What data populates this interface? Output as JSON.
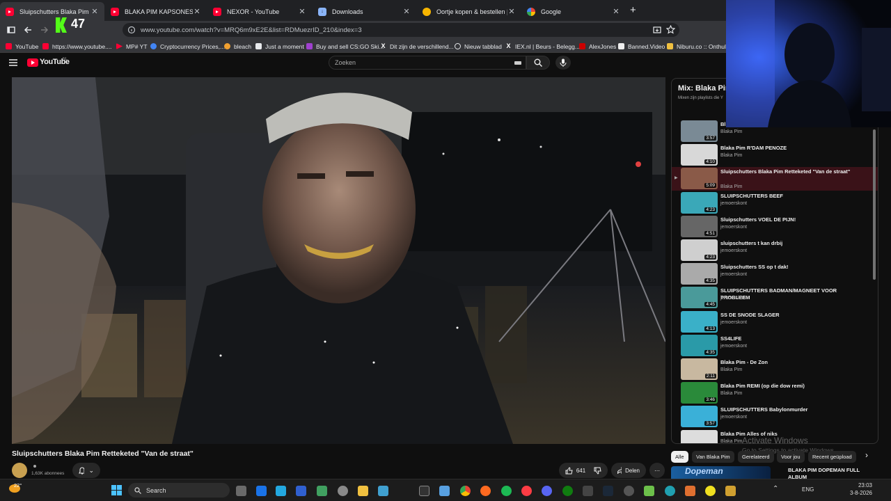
{
  "tabs": [
    {
      "title": "Sluipschutters Blaka Pim Re",
      "icon": "youtube-icon",
      "active": true
    },
    {
      "title": "BLAKA PIM KAPSONES - Yo",
      "icon": "youtube-icon"
    },
    {
      "title": "NEXOR - YouTube",
      "icon": "youtube-icon"
    },
    {
      "title": "Downloads",
      "icon": "download-icon"
    },
    {
      "title": "Oortje kopen & bestellen | Jum",
      "icon": "jumbo-icon"
    },
    {
      "title": "Google",
      "icon": "google-icon"
    }
  ],
  "new_tab": "+",
  "kick_count": "47",
  "address": "www.youtube.com/watch?v=MRQ6m9xE2E&list=RDMuezrID_210&index=3",
  "bookmarks": [
    "YouTube",
    "https://www.youtube....",
    "MP# YT",
    "Cryptocurrency Prices,...",
    "bleach",
    "Just a moment",
    "Buy and sell CS:GO Ski...",
    "Dit zijn de verschillend...",
    "Nieuw tabblad",
    "IEX.nl | Beurs - Belegg...",
    "AlexJones",
    "Banned.Video",
    "Niburu.co :: Onthulle"
  ],
  "yt": {
    "logo": "YouTube",
    "logo_sup": "NL",
    "search_placeholder": "Zoeken"
  },
  "video": {
    "title": "Sluipschutters Blaka Pim Retteketed \"Van de straat\"",
    "channel_subs": "1,63K abonnees",
    "likes": "641",
    "share": "Delen"
  },
  "playlist": {
    "title": "Mix: Blaka Pim",
    "subtitle": "Mixen zijn playlists die Y",
    "items": [
      {
        "title": "Bl",
        "channel": "Blaka Pim",
        "duration": "3:57",
        "thumb": "#7a8a95"
      },
      {
        "title": "Blaka Pim R'DAM PENOZE",
        "channel": "Blaka Pim",
        "duration": "4:10",
        "thumb": "#d8d8d8"
      },
      {
        "title": "Sluipschutters Blaka Pim Retteketed \"Van de straat\"",
        "channel": "Blaka Pim",
        "duration": "5:09",
        "thumb": "#8a5a48",
        "current": true
      },
      {
        "title": "SLUIPSCHUTTERS BEEF",
        "channel": "jemoerskont",
        "duration": "4:23",
        "thumb": "#3aa8b8"
      },
      {
        "title": "Sluipschutters VOEL DE PIJN!",
        "channel": "jemoerskont",
        "duration": "4:51",
        "thumb": "#666"
      },
      {
        "title": "sluipschutters t kan drbij",
        "channel": "jemoerskont",
        "duration": "4:23",
        "thumb": "#cfcfcf"
      },
      {
        "title": "Sluipschutters SS op t dak!",
        "channel": "jemoerskont",
        "duration": "4:35",
        "thumb": "#aaa"
      },
      {
        "title": "SLUIPSCHUTTERS BADMAN/MAGNEET VOOR PROBLEEM",
        "channel": "jemoerskont",
        "duration": "4:45",
        "thumb": "#4a9a9a"
      },
      {
        "title": "SS DE SNODE SLAGER",
        "channel": "jemoerskont",
        "duration": "4:13",
        "thumb": "#3ab0c8"
      },
      {
        "title": "SS4LIFE",
        "channel": "jemoerskont",
        "duration": "4:35",
        "thumb": "#2a9aa8"
      },
      {
        "title": "Blaka Pim - De Zon",
        "channel": "Blaka Pim",
        "duration": "2:11",
        "thumb": "#c8b8a0"
      },
      {
        "title": "Blaka Pim REMI (op die dow remi)",
        "channel": "Blaka Pim",
        "duration": "3:46",
        "thumb": "#2a8a3a"
      },
      {
        "title": "SLUIPSCHUTTERS Babylonmurder",
        "channel": "jemoerskont",
        "duration": "3:57",
        "thumb": "#3ab0d8"
      },
      {
        "title": "Blaka Pim Alles of niks",
        "channel": "Blaka Pim",
        "duration": "",
        "thumb": "#ddd"
      }
    ]
  },
  "chips": [
    "Alle",
    "Van Blaka Pim",
    "Gerelateerd",
    "Voor jou",
    "Recent geüpload"
  ],
  "next_video": {
    "thumb_text": "Dopeman",
    "title": "BLAKA PIM DOPEMAN FULL ALBUM"
  },
  "watermark": {
    "line1": "Activate Windows",
    "line2": "Go to Settings to activate Windows."
  },
  "taskbar": {
    "weather_temp": "22°",
    "search_label": "Search",
    "lang": "ENG",
    "time": "23:03",
    "date": "3-8-2026"
  }
}
